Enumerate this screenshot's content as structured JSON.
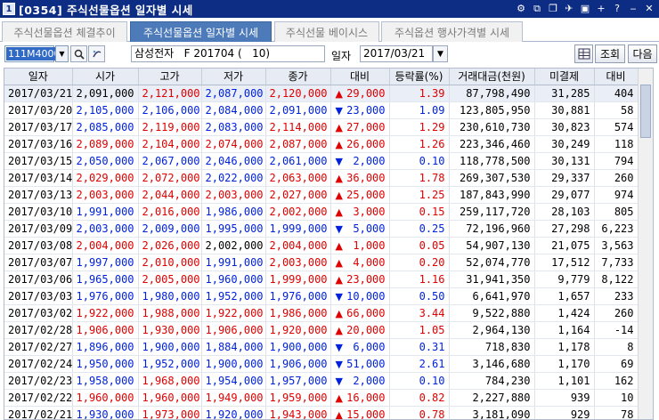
{
  "window": {
    "title": "[0354] 주식선물옵션 일자별 시세"
  },
  "tabs": [
    {
      "label": "주식선물옵션 체결추이"
    },
    {
      "label": "주식선물옵션 일자별 시세"
    },
    {
      "label": "주식선물 베이시스"
    },
    {
      "label": "주식옵션 행사가격별 시세"
    }
  ],
  "toolbar": {
    "code": "111M4000",
    "name": "삼성전자   F 201704 (   10)",
    "date_label": "일자",
    "date": "2017/03/21",
    "query_label": "조회",
    "next_label": "다음"
  },
  "table": {
    "headers": [
      "일자",
      "시가",
      "고가",
      "저가",
      "종가",
      "대비",
      "등락률(%)",
      "거래대금(천원)",
      "미결제",
      "대비"
    ],
    "rows": [
      {
        "date": "2017/03/21",
        "open": "2,091,000",
        "high": "2,121,000",
        "low": "2,087,000",
        "close": "2,120,000",
        "chg": "29,000",
        "rate": "1.39",
        "amount": "87,798,490",
        "oi": "31,285",
        "oichg": "404",
        "dir": "up",
        "oc": "blk",
        "hc": "up",
        "lc": "dn",
        "cc": "up"
      },
      {
        "date": "2017/03/20",
        "open": "2,105,000",
        "high": "2,106,000",
        "low": "2,084,000",
        "close": "2,091,000",
        "chg": "23,000",
        "rate": "1.09",
        "amount": "123,805,950",
        "oi": "30,881",
        "oichg": "58",
        "dir": "dn",
        "oc": "dn",
        "hc": "dn",
        "lc": "dn",
        "cc": "dn"
      },
      {
        "date": "2017/03/17",
        "open": "2,085,000",
        "high": "2,119,000",
        "low": "2,083,000",
        "close": "2,114,000",
        "chg": "27,000",
        "rate": "1.29",
        "amount": "230,610,730",
        "oi": "30,823",
        "oichg": "574",
        "dir": "up",
        "oc": "dn",
        "hc": "up",
        "lc": "dn",
        "cc": "up"
      },
      {
        "date": "2017/03/16",
        "open": "2,089,000",
        "high": "2,104,000",
        "low": "2,074,000",
        "close": "2,087,000",
        "chg": "26,000",
        "rate": "1.26",
        "amount": "223,346,460",
        "oi": "30,249",
        "oichg": "118",
        "dir": "up",
        "oc": "up",
        "hc": "up",
        "lc": "up",
        "cc": "up"
      },
      {
        "date": "2017/03/15",
        "open": "2,050,000",
        "high": "2,067,000",
        "low": "2,046,000",
        "close": "2,061,000",
        "chg": "2,000",
        "rate": "0.10",
        "amount": "118,778,500",
        "oi": "30,131",
        "oichg": "794",
        "dir": "dn",
        "oc": "dn",
        "hc": "dn",
        "lc": "dn",
        "cc": "dn"
      },
      {
        "date": "2017/03/14",
        "open": "2,029,000",
        "high": "2,072,000",
        "low": "2,022,000",
        "close": "2,063,000",
        "chg": "36,000",
        "rate": "1.78",
        "amount": "269,307,530",
        "oi": "29,337",
        "oichg": "260",
        "dir": "up",
        "oc": "up",
        "hc": "up",
        "lc": "dn",
        "cc": "up"
      },
      {
        "date": "2017/03/13",
        "open": "2,003,000",
        "high": "2,044,000",
        "low": "2,003,000",
        "close": "2,027,000",
        "chg": "25,000",
        "rate": "1.25",
        "amount": "187,843,990",
        "oi": "29,077",
        "oichg": "974",
        "dir": "up",
        "oc": "up",
        "hc": "up",
        "lc": "up",
        "cc": "up"
      },
      {
        "date": "2017/03/10",
        "open": "1,991,000",
        "high": "2,016,000",
        "low": "1,986,000",
        "close": "2,002,000",
        "chg": "3,000",
        "rate": "0.15",
        "amount": "259,117,720",
        "oi": "28,103",
        "oichg": "805",
        "dir": "up",
        "oc": "dn",
        "hc": "up",
        "lc": "dn",
        "cc": "up"
      },
      {
        "date": "2017/03/09",
        "open": "2,003,000",
        "high": "2,009,000",
        "low": "1,995,000",
        "close": "1,999,000",
        "chg": "5,000",
        "rate": "0.25",
        "amount": "72,196,960",
        "oi": "27,298",
        "oichg": "6,223",
        "dir": "dn",
        "oc": "dn",
        "hc": "dn",
        "lc": "dn",
        "cc": "dn"
      },
      {
        "date": "2017/03/08",
        "open": "2,004,000",
        "high": "2,026,000",
        "low": "2,002,000",
        "close": "2,004,000",
        "chg": "1,000",
        "rate": "0.05",
        "amount": "54,907,130",
        "oi": "21,075",
        "oichg": "3,563",
        "dir": "up",
        "oc": "up",
        "hc": "up",
        "lc": "blk",
        "cc": "up"
      },
      {
        "date": "2017/03/07",
        "open": "1,997,000",
        "high": "2,010,000",
        "low": "1,991,000",
        "close": "2,003,000",
        "chg": "4,000",
        "rate": "0.20",
        "amount": "52,074,770",
        "oi": "17,512",
        "oichg": "7,733",
        "dir": "up",
        "oc": "dn",
        "hc": "up",
        "lc": "dn",
        "cc": "up"
      },
      {
        "date": "2017/03/06",
        "open": "1,965,000",
        "high": "2,005,000",
        "low": "1,960,000",
        "close": "1,999,000",
        "chg": "23,000",
        "rate": "1.16",
        "amount": "31,941,350",
        "oi": "9,779",
        "oichg": "8,122",
        "dir": "up",
        "oc": "dn",
        "hc": "up",
        "lc": "dn",
        "cc": "up"
      },
      {
        "date": "2017/03/03",
        "open": "1,976,000",
        "high": "1,980,000",
        "low": "1,952,000",
        "close": "1,976,000",
        "chg": "10,000",
        "rate": "0.50",
        "amount": "6,641,970",
        "oi": "1,657",
        "oichg": "233",
        "dir": "dn",
        "oc": "dn",
        "hc": "dn",
        "lc": "dn",
        "cc": "dn"
      },
      {
        "date": "2017/03/02",
        "open": "1,922,000",
        "high": "1,988,000",
        "low": "1,922,000",
        "close": "1,986,000",
        "chg": "66,000",
        "rate": "3.44",
        "amount": "9,522,880",
        "oi": "1,424",
        "oichg": "260",
        "dir": "up",
        "oc": "up",
        "hc": "up",
        "lc": "up",
        "cc": "up"
      },
      {
        "date": "2017/02/28",
        "open": "1,906,000",
        "high": "1,930,000",
        "low": "1,906,000",
        "close": "1,920,000",
        "chg": "20,000",
        "rate": "1.05",
        "amount": "2,964,130",
        "oi": "1,164",
        "oichg": "-14",
        "dir": "up",
        "oc": "up",
        "hc": "up",
        "lc": "up",
        "cc": "up"
      },
      {
        "date": "2017/02/27",
        "open": "1,896,000",
        "high": "1,900,000",
        "low": "1,884,000",
        "close": "1,900,000",
        "chg": "6,000",
        "rate": "0.31",
        "amount": "718,830",
        "oi": "1,178",
        "oichg": "8",
        "dir": "dn",
        "oc": "dn",
        "hc": "dn",
        "lc": "dn",
        "cc": "dn"
      },
      {
        "date": "2017/02/24",
        "open": "1,950,000",
        "high": "1,952,000",
        "low": "1,900,000",
        "close": "1,906,000",
        "chg": "51,000",
        "rate": "2.61",
        "amount": "3,146,680",
        "oi": "1,170",
        "oichg": "69",
        "dir": "dn",
        "oc": "dn",
        "hc": "dn",
        "lc": "dn",
        "cc": "dn"
      },
      {
        "date": "2017/02/23",
        "open": "1,958,000",
        "high": "1,968,000",
        "low": "1,954,000",
        "close": "1,957,000",
        "chg": "2,000",
        "rate": "0.10",
        "amount": "784,230",
        "oi": "1,101",
        "oichg": "162",
        "dir": "dn",
        "oc": "dn",
        "hc": "up",
        "lc": "dn",
        "cc": "dn"
      },
      {
        "date": "2017/02/22",
        "open": "1,960,000",
        "high": "1,960,000",
        "low": "1,949,000",
        "close": "1,959,000",
        "chg": "16,000",
        "rate": "0.82",
        "amount": "2,227,880",
        "oi": "939",
        "oichg": "10",
        "dir": "up",
        "oc": "up",
        "hc": "up",
        "lc": "up",
        "cc": "up"
      },
      {
        "date": "2017/02/21",
        "open": "1,930,000",
        "high": "1,973,000",
        "low": "1,920,000",
        "close": "1,943,000",
        "chg": "15,000",
        "rate": "0.78",
        "amount": "3,181,090",
        "oi": "929",
        "oichg": "78",
        "dir": "up",
        "oc": "dn",
        "hc": "up",
        "lc": "dn",
        "cc": "up"
      }
    ]
  }
}
